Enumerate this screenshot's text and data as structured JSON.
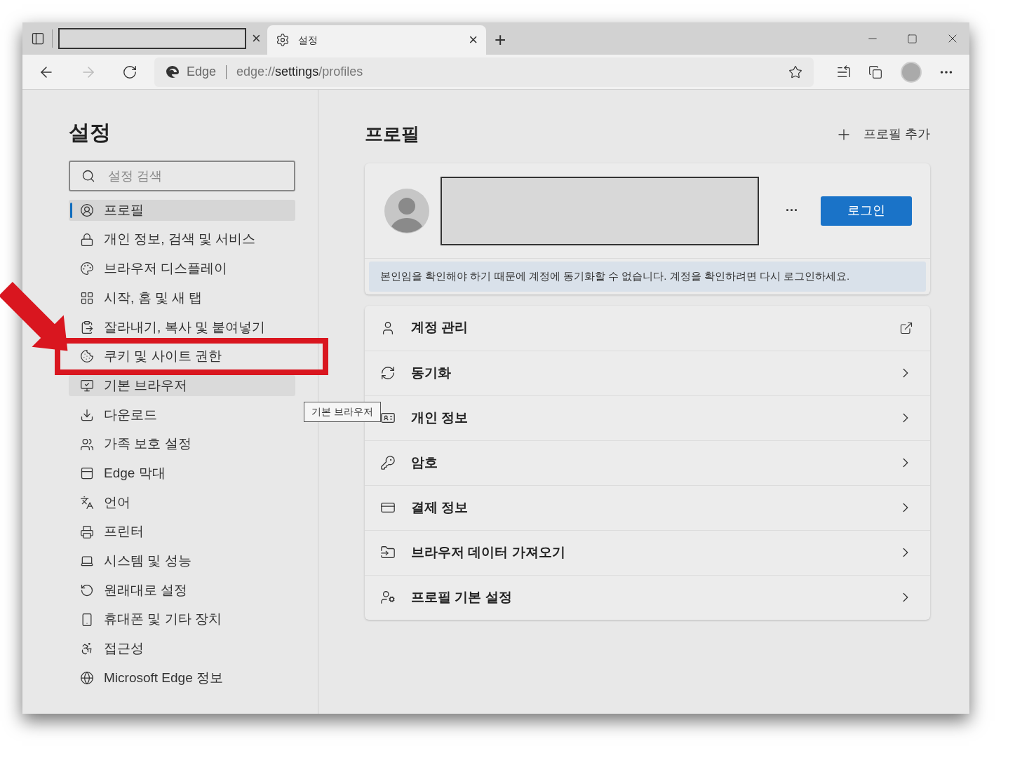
{
  "tabs": [
    {
      "redacted": true,
      "selected": false,
      "close": "×"
    },
    {
      "title": "설정",
      "redacted": false,
      "selected": true,
      "close": "×"
    }
  ],
  "new_tab": "+",
  "address_bar": {
    "site": "Edge",
    "url_parts": [
      {
        "text": "edge://",
        "emphasis": false
      },
      {
        "text": "settings",
        "emphasis": true
      },
      {
        "text": "/profiles",
        "emphasis": false
      }
    ]
  },
  "sidebar": {
    "title": "설정",
    "search": {
      "placeholder": "설정 검색"
    },
    "items": [
      {
        "label": "프로필",
        "selected": true,
        "hovered": false
      },
      {
        "label": "개인 정보, 검색 및 서비스",
        "selected": false,
        "hovered": false
      },
      {
        "label": "브라우저 디스플레이",
        "selected": false,
        "hovered": false
      },
      {
        "label": "시작, 홈 및 새 탭",
        "selected": false,
        "hovered": false
      },
      {
        "label": "잘라내기, 복사 및 붙여넣기",
        "selected": false,
        "hovered": false
      },
      {
        "label": "쿠키 및 사이트 권한",
        "selected": false,
        "hovered": false
      },
      {
        "label": "기본 브라우저",
        "selected": false,
        "hovered": true
      },
      {
        "label": "다운로드",
        "selected": false,
        "hovered": false
      },
      {
        "label": "가족 보호 설정",
        "selected": false,
        "hovered": false
      },
      {
        "label": "Edge 막대",
        "selected": false,
        "hovered": false
      },
      {
        "label": "언어",
        "selected": false,
        "hovered": false
      },
      {
        "label": "프린터",
        "selected": false,
        "hovered": false
      },
      {
        "label": "시스템 및 성능",
        "selected": false,
        "hovered": false
      },
      {
        "label": "원래대로 설정",
        "selected": false,
        "hovered": false
      },
      {
        "label": "휴대폰 및 기타 장치",
        "selected": false,
        "hovered": false
      },
      {
        "label": "접근성",
        "selected": false,
        "hovered": false
      },
      {
        "label": "Microsoft Edge 정보",
        "selected": false,
        "hovered": false
      }
    ]
  },
  "tooltip": "기본 브라우저",
  "main": {
    "title": "프로필",
    "add_profile": "프로필 추가",
    "profile_card": {
      "more": "···",
      "login_button": "로그인",
      "notice": "본인임을 확인해야 하기 때문에 계정에 동기화할 수 없습니다. 계정을 확인하려면 다시 로그인하세요."
    },
    "rows": [
      {
        "label": "계정 관리",
        "kind": "external"
      },
      {
        "label": "동기화",
        "kind": "chevron"
      },
      {
        "label": "개인 정보",
        "kind": "chevron"
      },
      {
        "label": "암호",
        "kind": "chevron"
      },
      {
        "label": "결제 정보",
        "kind": "chevron"
      },
      {
        "label": "브라우저 데이터 가져오기",
        "kind": "chevron"
      },
      {
        "label": "프로필 기본 설정",
        "kind": "chevron"
      }
    ]
  }
}
